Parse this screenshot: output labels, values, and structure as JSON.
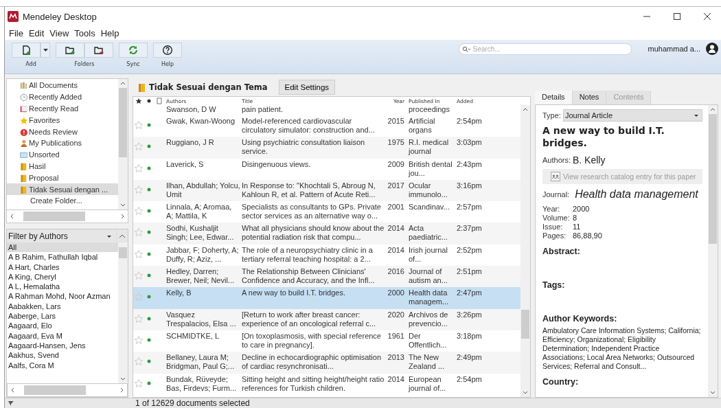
{
  "window": {
    "title": "Mendeley Desktop"
  },
  "menu": [
    "File",
    "Edit",
    "View",
    "Tools",
    "Help"
  ],
  "toolbar": {
    "groups": [
      {
        "label": "Add",
        "buttons": [
          {
            "kind": "add-document"
          },
          {
            "kind": "dropdown"
          }
        ]
      },
      {
        "label": "Folders",
        "buttons": [
          {
            "kind": "add-folder"
          },
          {
            "kind": "remove-folder"
          }
        ]
      },
      {
        "label": "Sync",
        "buttons": [
          {
            "kind": "sync"
          }
        ]
      },
      {
        "label": "Help",
        "buttons": [
          {
            "kind": "help"
          }
        ]
      }
    ],
    "search": {
      "placeholder": "Search..."
    },
    "user": "muhammad a..."
  },
  "collections": [
    {
      "label": "All Documents",
      "kind": "library",
      "selected": false
    },
    {
      "label": "Recently Added",
      "kind": "clock",
      "selected": false
    },
    {
      "label": "Recently Read",
      "kind": "book",
      "selected": false
    },
    {
      "label": "Favorites",
      "kind": "star",
      "selected": false
    },
    {
      "label": "Needs Review",
      "kind": "alert",
      "selected": false
    },
    {
      "label": "My Publications",
      "kind": "person",
      "selected": false
    },
    {
      "label": "Unsorted",
      "kind": "tray",
      "selected": false
    },
    {
      "label": "Hasil",
      "kind": "folder",
      "selected": false
    },
    {
      "label": "Proposal",
      "kind": "folder",
      "selected": false
    },
    {
      "label": "Tidak Sesuai dengan ...",
      "kind": "folder",
      "selected": true
    },
    {
      "label": "Create Folder...",
      "kind": "action",
      "selected": false
    }
  ],
  "filter": {
    "title": "Filter by Authors",
    "items": [
      {
        "label": "All",
        "selected": true
      },
      {
        "label": "A B Rahim, Fathullah Iqbal",
        "selected": false
      },
      {
        "label": "A Hart, Charles",
        "selected": false
      },
      {
        "label": "A King, Cheryl",
        "selected": false
      },
      {
        "label": "A L, Hemalatha",
        "selected": false
      },
      {
        "label": "A Rahman Mohd, Noor Azman",
        "selected": false
      },
      {
        "label": "Aabakken, Lars",
        "selected": false
      },
      {
        "label": "Aaberge, Lars",
        "selected": false
      },
      {
        "label": "Aagaard, Elo",
        "selected": false
      },
      {
        "label": "Aagaard, Eva M",
        "selected": false
      },
      {
        "label": "Aagaard-Hansen, Jens",
        "selected": false
      },
      {
        "label": "Aakhus, Svend",
        "selected": false
      },
      {
        "label": "Aalfs, Cora M",
        "selected": false
      }
    ]
  },
  "folder": {
    "title": "Tidak Sesuai dengan Tema",
    "button": "Edit Settings"
  },
  "table": {
    "columns": [
      "Authors",
      "Title",
      "Year",
      "Published In",
      "Added"
    ],
    "partial_row": {
      "authors": "Swanson, D W",
      "title": "pain patient.",
      "published_in": "proceedings"
    },
    "rows": [
      {
        "authors": "Gwak, Kwan-Woong",
        "title": "Model-referenced cardiovascular circulatory simulator: construction and...",
        "year": "2015",
        "published_in": "Artificial organs",
        "added": "2:54pm",
        "favorite": false,
        "unread": true,
        "selected": false
      },
      {
        "authors": "Ruggiano, J R",
        "title": "Using psychiatric consultation liaison service.",
        "year": "1975",
        "published_in": "R.I. medical journal",
        "added": "3:03pm",
        "favorite": false,
        "unread": true,
        "selected": false
      },
      {
        "authors": "Laverick, S",
        "title": "Disingenuous views.",
        "year": "2009",
        "published_in": "British dental jou...",
        "added": "2:43pm",
        "favorite": false,
        "unread": true,
        "selected": false
      },
      {
        "authors": "Ilhan, Abdullah; Yolcu, Umit",
        "title": "In Response to: \"Khochtali S, Abroug N, Kahloun R, et al. Pattern of Acute Reti...",
        "year": "2017",
        "published_in": "Ocular immunolo...",
        "added": "3:16pm",
        "favorite": false,
        "unread": true,
        "selected": false
      },
      {
        "authors": "Linnala, A; Aromaa, A; Mattila, K",
        "title": "Specialists as consultants to GPs. Private sector services as an alternative way o...",
        "year": "2001",
        "published_in": "Scandinav...",
        "added": "2:57pm",
        "favorite": false,
        "unread": true,
        "selected": false
      },
      {
        "authors": "Sodhi, Kushaljit Singh; Lee, Edwar...",
        "title": "What all physicians should know about the potential radiation risk that compu...",
        "year": "2014",
        "published_in": "Acta paediatric...",
        "added": "2:37pm",
        "favorite": false,
        "unread": true,
        "selected": false
      },
      {
        "authors": "Jabbar, F; Doherty, A; Duffy, R; Aziz, ...",
        "title": "The role of a neuropsychiatry clinic in a tertiary referral teaching hospital: a 2...",
        "year": "2014",
        "published_in": "Irish journal of...",
        "added": "2:52pm",
        "favorite": false,
        "unread": true,
        "selected": false
      },
      {
        "authors": "Hedley, Darren; Brewer, Neil; Nevil...",
        "title": "The Relationship Between Clinicians' Confidence and Accuracy, and the Infl...",
        "year": "2016",
        "published_in": "Journal of autism an...",
        "added": "2:51pm",
        "favorite": false,
        "unread": true,
        "selected": false
      },
      {
        "authors": "Kelly, B",
        "title": "A new way to build I.T. bridges.",
        "year": "2000",
        "published_in": "Health data managem...",
        "added": "2:47pm",
        "favorite": false,
        "unread": true,
        "selected": true
      },
      {
        "authors": "Vasquez Trespalacios, Elsa ...",
        "title": "[Return to work after breast cancer: experience of an oncological referral c...",
        "year": "2020",
        "published_in": "Archivos de prevencio...",
        "added": "3:26pm",
        "favorite": false,
        "unread": true,
        "selected": false
      },
      {
        "authors": "SCHMIDTKE, L",
        "title": "[On toxoplasmosis, with special reference to care in pregnancy].",
        "year": "1961",
        "published_in": "Der Offentlich...",
        "added": "3:18pm",
        "favorite": false,
        "unread": true,
        "selected": false
      },
      {
        "authors": "Bellaney, Laura M; Bridgman, Paul G;...",
        "title": "Decline in echocardiographic optimisation of cardiac resynchronisati...",
        "year": "2013",
        "published_in": "The New Zealand ...",
        "added": "2:49pm",
        "favorite": false,
        "unread": true,
        "selected": false
      },
      {
        "authors": "Bundak, Rüveyde; Bas, Firdevs; Furm...",
        "title": "Sitting height and sitting height/height ratio references for Turkish children.",
        "year": "2014",
        "published_in": "European journal of...",
        "added": "2:54pm",
        "favorite": false,
        "unread": true,
        "selected": false
      }
    ]
  },
  "details": {
    "tabs": [
      {
        "label": "Details",
        "selected": true,
        "disabled": false
      },
      {
        "label": "Notes",
        "selected": false,
        "disabled": false
      },
      {
        "label": "Contents",
        "selected": false,
        "disabled": true
      }
    ],
    "type_label": "Type:",
    "type": "Journal Article",
    "title": "A new way to build I.T. bridges.",
    "authors_label": "Authors:",
    "authors": "B. Kelly",
    "catalog_button": "View research catalog entry for this paper",
    "journal_label": "Journal:",
    "journal": "Health data management",
    "fields": [
      {
        "label": "Year:",
        "value": "2000"
      },
      {
        "label": "Volume:",
        "value": "8"
      },
      {
        "label": "Issue:",
        "value": "11"
      },
      {
        "label": "Pages:",
        "value": "86,88,90"
      }
    ],
    "sections": [
      {
        "heading": "Abstract:"
      },
      {
        "heading": "Tags:"
      },
      {
        "heading": "Author Keywords:",
        "text": "Ambulatory Care Information Systems; California; Efficiency; Organizational; Eligibility Determination; Independent Practice Associations; Local Area Networks; Outsourced Services; Referral and Consult..."
      },
      {
        "heading": "Country:"
      }
    ]
  },
  "status_bar": "1 of 12629 documents selected"
}
